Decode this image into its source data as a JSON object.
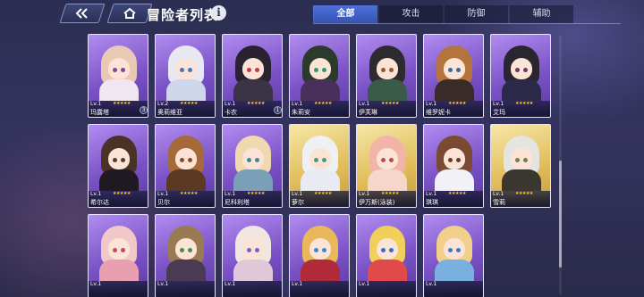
{
  "header": {
    "title": "冒险者列表",
    "info_label": "i",
    "back_icon": "back-arrow-icon",
    "home_icon": "home-icon"
  },
  "tabs": [
    {
      "label": "全部",
      "active": true
    },
    {
      "label": "攻击",
      "active": false
    },
    {
      "label": "防御",
      "active": false
    },
    {
      "label": "辅助",
      "active": false
    }
  ],
  "colors": {
    "accent": "#3f5fc8",
    "rarity_purple": "#8a60d6",
    "rarity_gold": "#e2bf5e",
    "star": "#ffcf3a"
  },
  "adventurers": [
    {
      "name": "玛露塔",
      "level": "Lv.1",
      "stars": "★★★★★",
      "rarity": "purple",
      "badge": "3",
      "hair": "#e9c9b3",
      "outfit": "#f0e6f2",
      "eyes": "#7d4a8a"
    },
    {
      "name": "奥莉维亚",
      "level": "Lv.2",
      "stars": "★★★★★",
      "rarity": "purple",
      "badge": "",
      "hair": "#e8e8f2",
      "outfit": "#cfd6ea",
      "eyes": "#4a72b8"
    },
    {
      "name": "卡农",
      "level": "Lv.1",
      "stars": "★★★★★",
      "rarity": "purple",
      "badge": "1",
      "hair": "#2a2230",
      "outfit": "#3b3445",
      "eyes": "#c23a4a"
    },
    {
      "name": "朱莉安",
      "level": "Lv.1",
      "stars": "★★★★★",
      "rarity": "purple",
      "badge": "",
      "hair": "#2c3a2e",
      "outfit": "#4a2f5a",
      "eyes": "#2f9a6a"
    },
    {
      "name": "伊芙琳",
      "level": "Lv.1",
      "stars": "★★★★★",
      "rarity": "purple",
      "badge": "",
      "hair": "#2d2a30",
      "outfit": "#3a5a4a",
      "eyes": "#8a5a3a"
    },
    {
      "name": "维罗妮卡",
      "level": "Lv.1",
      "stars": "★★★★★",
      "rarity": "purple",
      "badge": "",
      "hair": "#b5743c",
      "outfit": "#3a2a2a",
      "eyes": "#3a6a9a"
    },
    {
      "name": "艾玛",
      "level": "Lv.1",
      "stars": "★★★★★",
      "rarity": "purple",
      "badge": "",
      "hair": "#2a2630",
      "outfit": "#2a2a48",
      "eyes": "#6a3a5a"
    },
    {
      "name": "希尔达",
      "level": "Lv.1",
      "stars": "★★★★★",
      "rarity": "purple",
      "badge": "",
      "hair": "#4a3226",
      "outfit": "#1f1a22",
      "eyes": "#5a3a2a"
    },
    {
      "name": "贝尔",
      "level": "Lv.1",
      "stars": "★★★★★",
      "rarity": "purple",
      "badge": "",
      "hair": "#a66a3a",
      "outfit": "#5a3a22",
      "eyes": "#8a4a2a"
    },
    {
      "name": "尼科利塔",
      "level": "Lv.1",
      "stars": "★★★★★",
      "rarity": "purple",
      "badge": "",
      "hair": "#f0d9b0",
      "outfit": "#7aa0b8",
      "eyes": "#3a8a9a"
    },
    {
      "name": "萝尔",
      "level": "Lv.1",
      "stars": "★★★★★",
      "rarity": "gold",
      "badge": "",
      "hair": "#eef0f4",
      "outfit": "#e8ecf2",
      "eyes": "#4a9a7a"
    },
    {
      "name": "伊万斯(泳装)",
      "level": "Lv.1",
      "stars": "★★★★★",
      "rarity": "gold",
      "badge": "",
      "hair": "#f2b4a8",
      "outfit": "#f6d6c8",
      "eyes": "#c04a4a"
    },
    {
      "name": "琪琪",
      "level": "Lv.1",
      "stars": "★★★★★",
      "rarity": "purple",
      "badge": "",
      "hair": "#7a4a32",
      "outfit": "#f2f2f6",
      "eyes": "#6a3a2a"
    },
    {
      "name": "雪莉",
      "level": "Lv.1",
      "stars": "★★★★★",
      "rarity": "gold",
      "badge": "",
      "hair": "#e6e4e0",
      "outfit": "#3a3630",
      "eyes": "#7a7a4a"
    },
    {
      "name": "",
      "level": "Lv.1",
      "stars": "",
      "rarity": "purple",
      "badge": "",
      "hair": "#f0c8c8",
      "outfit": "#e8a0b0",
      "eyes": "#c04a6a"
    },
    {
      "name": "",
      "level": "Lv.1",
      "stars": "",
      "rarity": "purple",
      "badge": "",
      "hair": "#9a7a52",
      "outfit": "#4a3a52",
      "eyes": "#4a8a4a"
    },
    {
      "name": "",
      "level": "Lv.1",
      "stars": "",
      "rarity": "purple",
      "badge": "",
      "hair": "#f2e6e0",
      "outfit": "#e0c8d8",
      "eyes": "#6a6ac0"
    },
    {
      "name": "",
      "level": "Lv.1",
      "stars": "",
      "rarity": "purple",
      "badge": "",
      "hair": "#e8b85a",
      "outfit": "#b02a3a",
      "eyes": "#3a8ac0"
    },
    {
      "name": "",
      "level": "Lv.1",
      "stars": "",
      "rarity": "purple",
      "badge": "",
      "hair": "#f0cf5a",
      "outfit": "#e04a4a",
      "eyes": "#3a6ac0"
    },
    {
      "name": "",
      "level": "Lv.1",
      "stars": "",
      "rarity": "purple",
      "badge": "",
      "hair": "#f0d08a",
      "outfit": "#7ab0e0",
      "eyes": "#3a7ac0"
    }
  ]
}
